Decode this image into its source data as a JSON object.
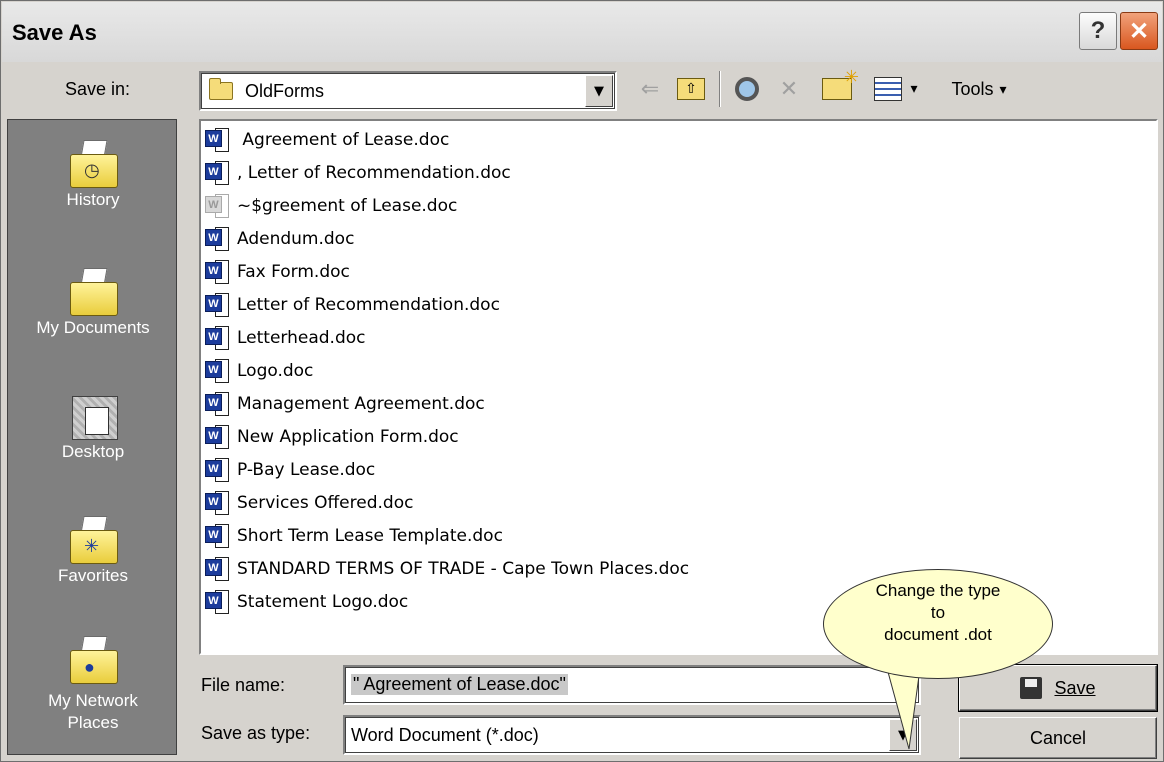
{
  "window": {
    "title": "Save As",
    "help_glyph": "?",
    "close_glyph": "✕"
  },
  "toolbar": {
    "save_in_label": "Save in:",
    "save_in_mnemonic": "i",
    "current_folder": "OldForms",
    "back_glyph": "⇐",
    "up_glyph": "⇧",
    "search_glyph": "🔍",
    "delete_glyph": "✕",
    "new_folder_glyph": "📁",
    "views_glyph": "▦",
    "tools_label": "Tools",
    "dropdown_glyph": "▾"
  },
  "places": [
    {
      "label": "History",
      "icon": "history-folder-icon"
    },
    {
      "label": "My Documents",
      "icon": "my-documents-folder-icon"
    },
    {
      "label": "Desktop",
      "icon": "desktop-icon"
    },
    {
      "label": "Favorites",
      "icon": "favorites-folder-icon"
    },
    {
      "label": "My Network Places",
      "icon": "network-places-icon"
    }
  ],
  "files": [
    {
      "name": " Agreement of Lease.doc",
      "ghost": false
    },
    {
      "name": ", Letter of Recommendation.doc",
      "ghost": false
    },
    {
      "name": "~$greement of Lease.doc",
      "ghost": true
    },
    {
      "name": "Adendum.doc",
      "ghost": false
    },
    {
      "name": "Fax Form.doc",
      "ghost": false
    },
    {
      "name": "Letter of Recommendation.doc",
      "ghost": false
    },
    {
      "name": "Letterhead.doc",
      "ghost": false
    },
    {
      "name": "Logo.doc",
      "ghost": false
    },
    {
      "name": "Management Agreement.doc",
      "ghost": false
    },
    {
      "name": "New Application Form.doc",
      "ghost": false
    },
    {
      "name": "P-Bay Lease.doc",
      "ghost": false
    },
    {
      "name": "Services Offered.doc",
      "ghost": false
    },
    {
      "name": "Short Term Lease Template.doc",
      "ghost": false
    },
    {
      "name": "STANDARD TERMS OF TRADE - Cape Town Places.doc",
      "ghost": false
    },
    {
      "name": "Statement Logo.doc",
      "ghost": false
    }
  ],
  "form": {
    "file_name_label": "File name:",
    "file_name_value": "\" Agreement of Lease.doc\"",
    "save_as_type_label": "Save as type:",
    "save_as_type_value": "Word Document (*.doc)",
    "save_button": "Save",
    "cancel_button": "Cancel"
  },
  "callout": {
    "line1": "Change the type",
    "line2": "to",
    "line3": "document .dot"
  }
}
